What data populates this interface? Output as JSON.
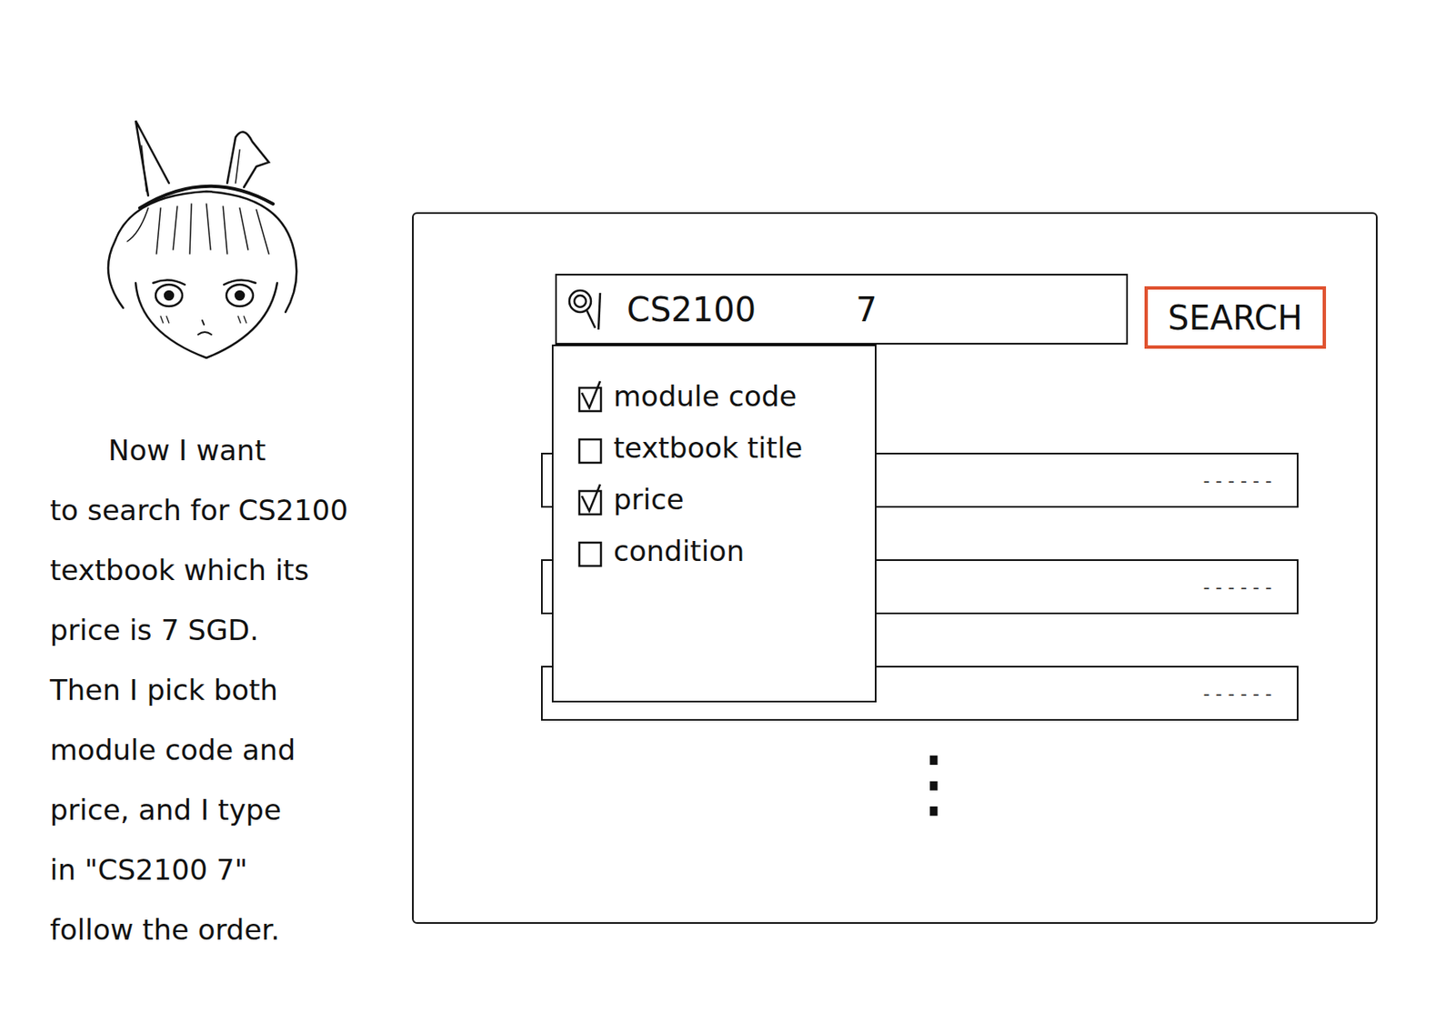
{
  "caption": [
    "Now I want",
    "to search for CS2100",
    "textbook which its",
    "price is 7 SGD.",
    "Then I pick both",
    "module code and",
    "price, and I type",
    "in \"CS2100 7\"",
    "follow the order."
  ],
  "search": {
    "query_parts": [
      "CS2100",
      "7"
    ],
    "button": "SEARCH"
  },
  "filters": [
    {
      "label": "module code",
      "checked": true
    },
    {
      "label": "textbook title",
      "checked": false
    },
    {
      "label": "price",
      "checked": true
    },
    {
      "label": "condition",
      "checked": false
    }
  ],
  "results": [
    {
      "text": "- - - - - -"
    },
    {
      "text": "- - - - - -"
    },
    {
      "text": "- - - - - -"
    }
  ],
  "more": "⋮"
}
